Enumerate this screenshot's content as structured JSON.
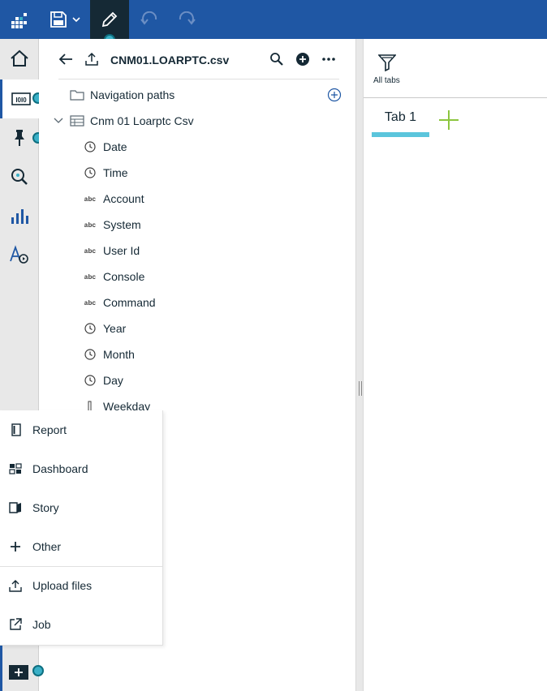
{
  "colors": {
    "topbar": "#1f57a4",
    "active_dark": "#152935",
    "hotspot": "#3ab0c7",
    "tab_underline": "#5bc5dc",
    "add_tab": "#8cc63f"
  },
  "topbar": {
    "icons": [
      "app-switcher-icon",
      "save-icon",
      "chevron-down-icon",
      "edit-pencil-icon",
      "undo-icon",
      "redo-icon"
    ]
  },
  "leftrail": {
    "icons": [
      "home-icon",
      "data-sources-icon",
      "pin-icon",
      "navigate-search-icon",
      "visualizations-icon",
      "text-shapes-icon"
    ]
  },
  "datapanel": {
    "title": "CNM01.LOARPTC.csv",
    "navigation_paths": "Navigation paths",
    "table_name": "Cnm 01 Loarptc Csv",
    "type_text_badge": "abc",
    "fields": [
      {
        "label": "Date",
        "type": "time"
      },
      {
        "label": "Time",
        "type": "time"
      },
      {
        "label": "Account",
        "type": "text"
      },
      {
        "label": "System",
        "type": "text"
      },
      {
        "label": "User Id",
        "type": "text"
      },
      {
        "label": "Console",
        "type": "text"
      },
      {
        "label": "Command",
        "type": "text"
      },
      {
        "label": "Year",
        "type": "time"
      },
      {
        "label": "Month",
        "type": "time"
      },
      {
        "label": "Day",
        "type": "time"
      },
      {
        "label": "Weekday",
        "type": "measure"
      }
    ]
  },
  "canvas": {
    "all_tabs_label": "All tabs",
    "tabs": [
      {
        "label": "Tab 1"
      }
    ]
  },
  "new_menu": {
    "items": [
      {
        "label": "Report",
        "icon": "report-icon"
      },
      {
        "label": "Dashboard",
        "icon": "dashboard-icon"
      },
      {
        "label": "Story",
        "icon": "story-icon"
      },
      {
        "label": "Other",
        "icon": "plus-icon"
      },
      {
        "label": "Upload files",
        "icon": "upload-icon"
      },
      {
        "label": "Job",
        "icon": "launch-icon"
      }
    ]
  }
}
